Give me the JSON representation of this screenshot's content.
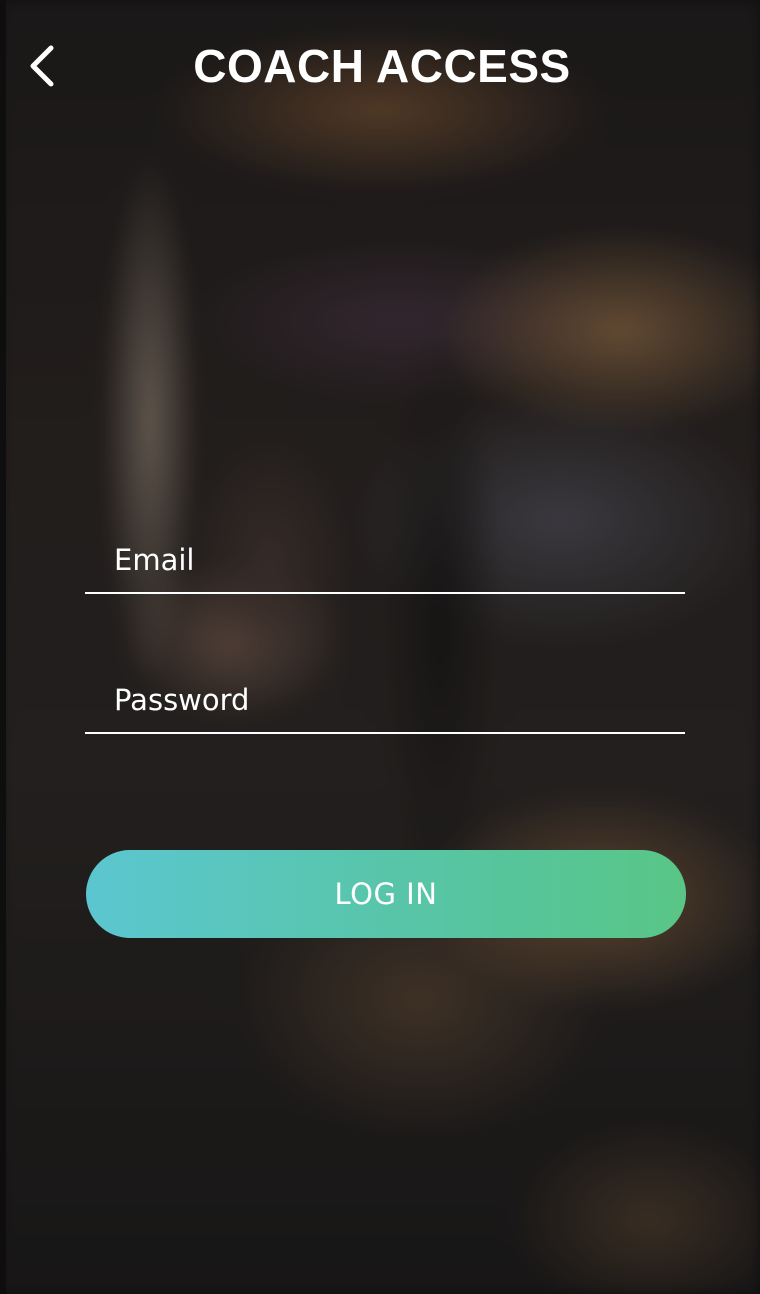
{
  "header": {
    "title": "COACH ACCESS",
    "back_icon": "chevron-left-icon"
  },
  "form": {
    "email": {
      "placeholder": "Email",
      "value": ""
    },
    "password": {
      "placeholder": "Password",
      "value": ""
    }
  },
  "actions": {
    "login_label": "LOG IN"
  },
  "colors": {
    "button_gradient_start": "#5bc6d0",
    "button_gradient_end": "#59c686",
    "text": "#ffffff"
  }
}
